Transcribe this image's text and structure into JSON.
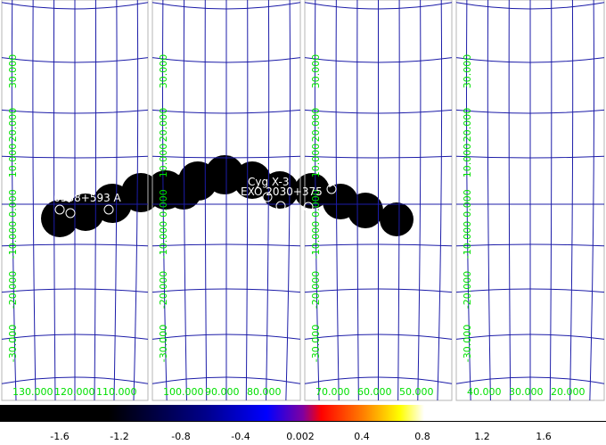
{
  "panels": [
    {
      "ra_labels": [
        "130.000",
        "120.000",
        "110.000"
      ],
      "dec_labels": [
        "30.000",
        "20.000",
        "10.000",
        "0.000",
        "-10.000",
        "-20.000",
        "-30.000"
      ]
    },
    {
      "ra_labels": [
        "100.000",
        "90.000",
        "80.000"
      ],
      "dec_labels": [
        "30.000",
        "20.000",
        "10.000",
        "0.000",
        "-10.000",
        "-20.000",
        "-30.000"
      ]
    },
    {
      "ra_labels": [
        "70.000",
        "60.000",
        "50.000"
      ],
      "dec_labels": [
        "30.000",
        "20.000",
        "10.000",
        "0.000",
        "-10.000",
        "-20.000",
        "-30.000"
      ]
    },
    {
      "ra_labels": [
        "40.000",
        "30.000",
        "20.000"
      ],
      "dec_labels": [
        "30.000",
        "20.000",
        "10.000",
        "0.000",
        "-10.000",
        "-20.000",
        "-30.000"
      ]
    }
  ],
  "sources": [
    {
      "label": "4U 0538+593 A",
      "panel": 0
    },
    {
      "label": "Cyg X-3",
      "panel": 2
    },
    {
      "label": "EXO 2030+375",
      "panel": 2
    }
  ],
  "colorbar": {
    "ticks": [
      "-1.6",
      "-1.2",
      "-0.8",
      "-0.4",
      "0.002",
      "0.4",
      "0.8",
      "1.2",
      "1.6"
    ]
  },
  "colors": {
    "grid": "#1c1ca8",
    "frame": "#b4b4b4",
    "label": "#00e000",
    "source": "#ffffff",
    "blob": "#000000"
  }
}
